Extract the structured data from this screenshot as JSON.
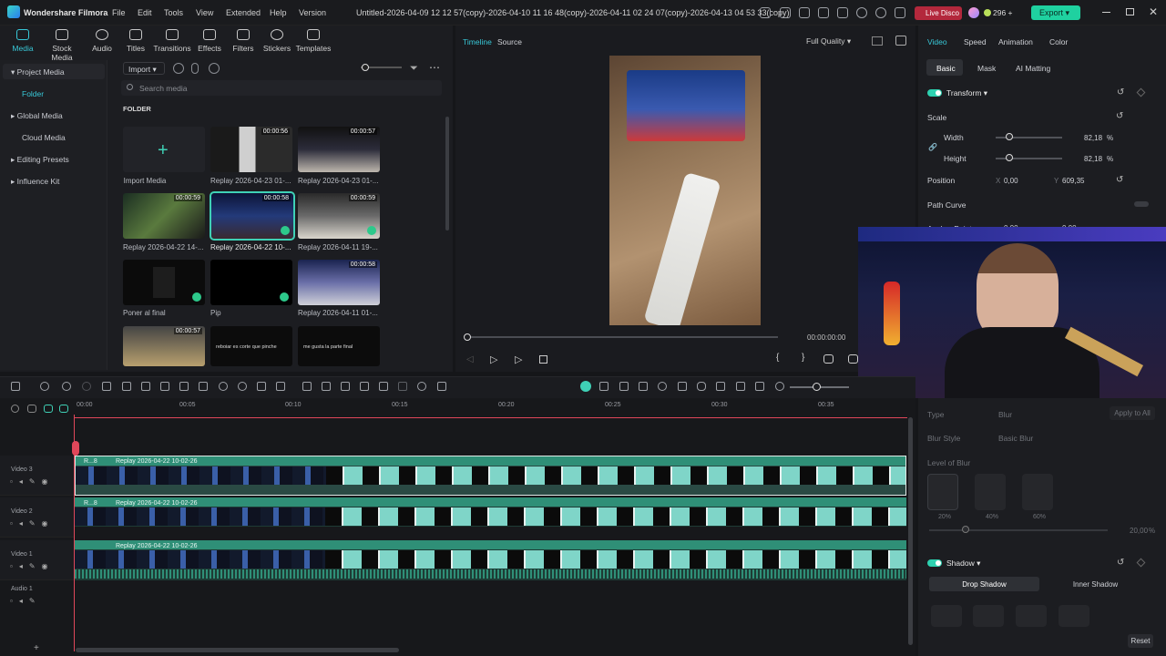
{
  "app": {
    "name": "Wondershare Filmora",
    "project_title": "Untitled-2026-04-09 12 12 57(copy)-2026-04-10 11 16 48(copy)-2026-04-11 02 24 07(copy)-2026-04-13 04 53 33(copy)"
  },
  "menu": [
    "File",
    "Edit",
    "Tools",
    "View",
    "Extended",
    "Help",
    "Version"
  ],
  "topbar": {
    "live_label": "Live Disco",
    "credits": "296",
    "export_label": "Export"
  },
  "media_tabs": [
    "Media",
    "Stock Media",
    "Audio",
    "Titles",
    "Transitions",
    "Effects",
    "Filters",
    "Stickers",
    "Templates"
  ],
  "sidebar": [
    "Project Media",
    "Folder",
    "Global Media",
    "Cloud Media",
    "Editing Presets",
    "Influence Kit"
  ],
  "import_label": "Import",
  "search_placeholder": "Search media",
  "folder_label": "FOLDER",
  "thumbs": [
    {
      "name": "Import Media",
      "dur": ""
    },
    {
      "name": "Replay 2026-04-23 01-...",
      "dur": "00:00:56"
    },
    {
      "name": "Replay 2026-04-23 01-...",
      "dur": "00:00:57"
    },
    {
      "name": "Replay 2026-04-22 14-...",
      "dur": "00:00:59"
    },
    {
      "name": "Replay 2026-04-22 10-...",
      "dur": "00:00:58"
    },
    {
      "name": "Replay 2026-04-11 19-...",
      "dur": "00:00:59"
    },
    {
      "name": "Poner al final",
      "dur": ""
    },
    {
      "name": "Pip",
      "dur": ""
    },
    {
      "name": "Replay 2026-04-11 01-...",
      "dur": "00:00:58"
    },
    {
      "name": "",
      "dur": "00:00:57"
    },
    {
      "name": "",
      "dur": "",
      "caption": "reboiar es corte que pinche"
    },
    {
      "name": "",
      "dur": "",
      "caption": "me gusta la parte final"
    }
  ],
  "preview": {
    "tab_timeline": "Timeline",
    "tab_source": "Source",
    "quality": "Full Quality",
    "timecode": "00:00:00:00"
  },
  "right": {
    "tabs": [
      "Video",
      "Speed",
      "Animation",
      "Color"
    ],
    "subtabs": [
      "Basic",
      "Mask",
      "AI Matting"
    ],
    "transform": "Transform",
    "scale": "Scale",
    "width_label": "Width",
    "width_value": "82,18",
    "width_unit": "%",
    "height_label": "Height",
    "height_value": "82,18",
    "height_unit": "%",
    "position": "Position",
    "pos_x_label": "X",
    "pos_x": "0,00",
    "pos_y_label": "Y",
    "pos_y": "609,35",
    "path_curve": "Path Curve",
    "anchor_point": "Anchor Point",
    "anchor_x": "0,00",
    "anchor_y": "0,00",
    "type_label": "Type",
    "type_value": "Blur",
    "apply_all": "Apply to All",
    "blur_style": "Blur Style",
    "blur_value": "Basic Blur",
    "level_blur": "Level of Blur",
    "level_pcts": [
      "20%",
      "40%",
      "60%"
    ],
    "blur_amount": "20,00",
    "blur_unit": "%",
    "shadow": "Shadow",
    "drop_shadow": "Drop Shadow",
    "inner_shadow": "Inner Shadow",
    "reset": "Reset"
  },
  "ruler": [
    "00:00",
    "00:05",
    "00:10",
    "00:15",
    "00:20",
    "00:25",
    "00:30",
    "00:35"
  ],
  "tracks": [
    {
      "label": "Video 3",
      "clip": "Replay 2026-04-22 10-02-26",
      "tag": "R...8"
    },
    {
      "label": "Video 2",
      "clip": "Replay 2026-04-22 10-02-26",
      "tag": "R...8"
    },
    {
      "label": "Video 1",
      "clip": "Replay 2026-04-22 10-02-26",
      "tag": ""
    },
    {
      "label": "Audio 1",
      "clip": "",
      "tag": ""
    }
  ],
  "colors": {
    "accent": "#38c8d8",
    "export": "#1fd1a0",
    "playhead": "#e0475a",
    "clip": "#1e3b35"
  }
}
